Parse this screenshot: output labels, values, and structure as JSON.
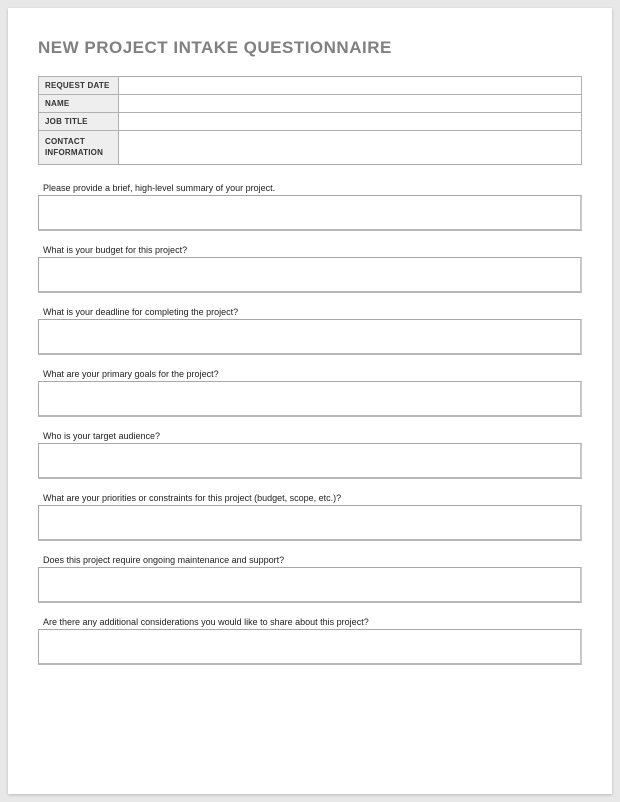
{
  "title": "NEW PROJECT INTAKE QUESTIONNAIRE",
  "info_rows": [
    {
      "label": "REQUEST DATE",
      "value": ""
    },
    {
      "label": "NAME",
      "value": ""
    },
    {
      "label": "JOB TITLE",
      "value": ""
    },
    {
      "label": "CONTACT INFORMATION",
      "value": ""
    }
  ],
  "questions": [
    {
      "label": "Please provide a brief, high-level summary of your project.",
      "value": ""
    },
    {
      "label": "What is your budget for this project?",
      "value": ""
    },
    {
      "label": "What is your deadline for completing the project?",
      "value": ""
    },
    {
      "label": "What are your primary goals for the project?",
      "value": ""
    },
    {
      "label": "Who is your target audience?",
      "value": ""
    },
    {
      "label": "What are your priorities or constraints for this project (budget, scope, etc.)?",
      "value": ""
    },
    {
      "label": "Does this project require ongoing maintenance and support?",
      "value": ""
    },
    {
      "label": "Are there any additional considerations you would like to share about this project?",
      "value": ""
    }
  ]
}
